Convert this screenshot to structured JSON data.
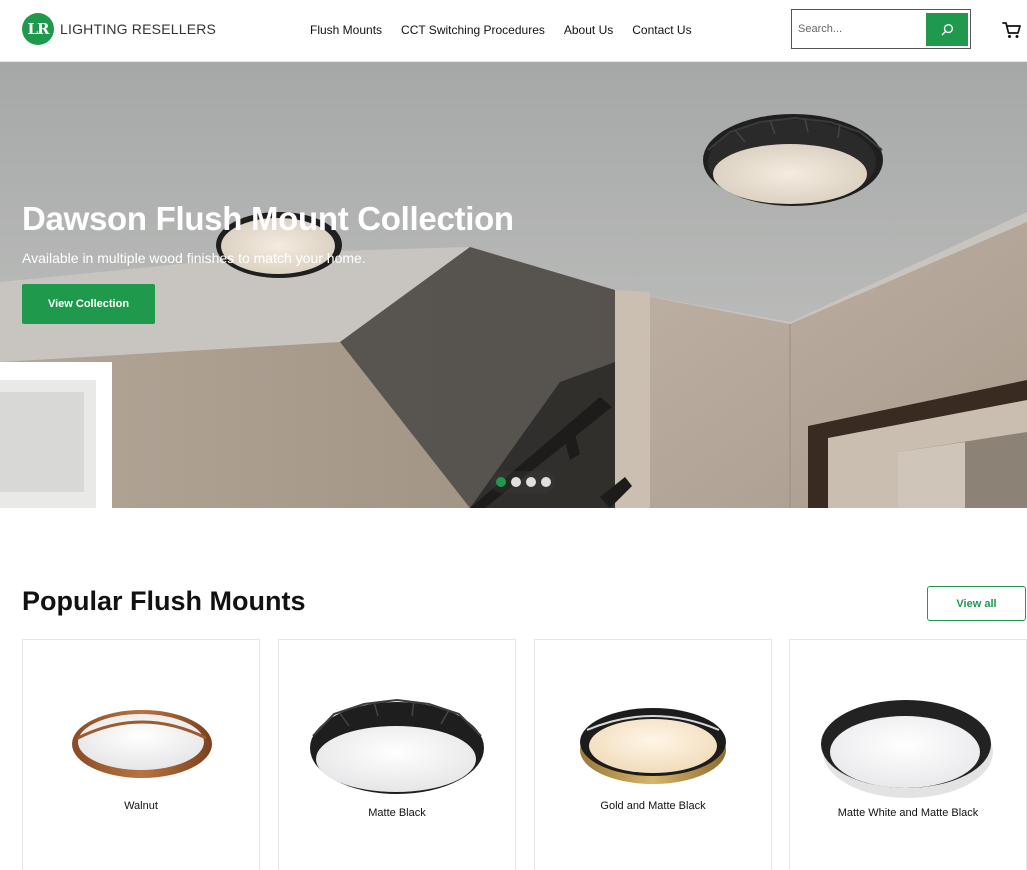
{
  "header": {
    "logo_mark": "LR",
    "logo_text": "LIGHTING RESELLERS",
    "nav": [
      "Flush Mounts",
      "CCT Switching Procedures",
      "About Us",
      "Contact Us"
    ],
    "search_placeholder": "Search...",
    "search_icon": "search-icon",
    "cart_icon": "cart-icon"
  },
  "hero": {
    "title": "Dawson Flush Mount Collection",
    "subtitle": "Available in multiple wood finishes to match your home.",
    "button_label": "View Collection",
    "slides_total": 4,
    "slide_active": 1
  },
  "section": {
    "title": "Popular Flush Mounts",
    "view_all_label": "View all"
  },
  "products": [
    {
      "label": "Walnut"
    },
    {
      "label": "Matte Black"
    },
    {
      "label": "Gold and Matte Black"
    },
    {
      "label": "Matte White and Matte Black"
    }
  ],
  "colors": {
    "accent": "#1f9a4d",
    "text": "#111111"
  }
}
